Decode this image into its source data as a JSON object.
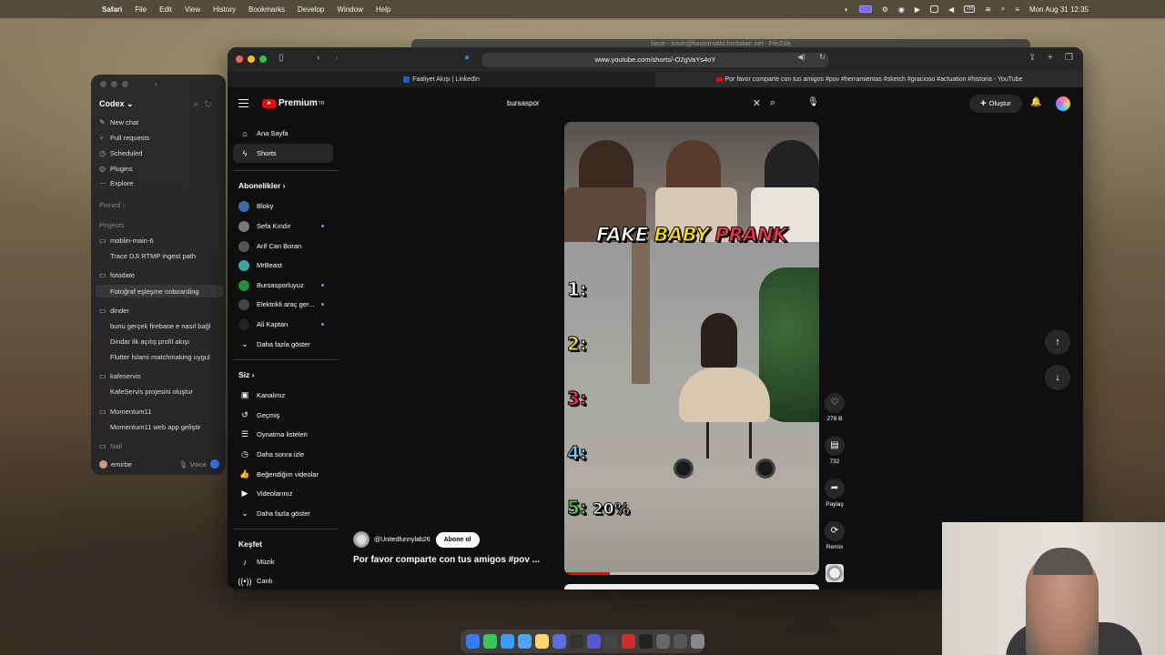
{
  "menubar": {
    "app": "Safari",
    "items": [
      "File",
      "Edit",
      "View",
      "History",
      "Bookmarks",
      "Develop",
      "Window",
      "Help"
    ],
    "clock": "Mon Aug 31  12:35",
    "lang": "TR"
  },
  "codex": {
    "title": "Codex",
    "nav": [
      {
        "label": "New chat",
        "icon": "compose-icon"
      },
      {
        "label": "Pull requests",
        "icon": "pr-icon"
      },
      {
        "label": "Scheduled",
        "icon": "clock-icon"
      },
      {
        "label": "Plugins",
        "icon": "plugin-icon"
      },
      {
        "label": "Explore",
        "icon": "dots-icon"
      }
    ],
    "pinned": "Pinned",
    "projects_label": "Projects",
    "projects": [
      {
        "name": "moblin-main-6",
        "items": [
          "Trace DJI RTMP ingest path"
        ]
      },
      {
        "name": "fotodate",
        "items": [
          "Fotoğraf eşleşme onboarding"
        ]
      },
      {
        "name": "dinder",
        "items": [
          "bunu gerçek firebase e nasıl bağl",
          "Dindar ilk açılış profil akışı",
          "Flutter İslami matchmaking uygul"
        ]
      },
      {
        "name": "kafeservis",
        "items": [
          "KafeServis projesini oluştur"
        ]
      },
      {
        "name": "Momentum11",
        "items": [
          "Momentum11 web app geliştir"
        ]
      },
      {
        "name": "Nail",
        "items": []
      }
    ],
    "user": "emirbe",
    "voice": "Voice"
  },
  "filezilla": {
    "title": "kavin - kavin@kavinmiatto.hostalain.net - FileZilla"
  },
  "safari": {
    "url": "www.youtube.com/shorts/-O2gVaYs4oY",
    "tabs": [
      {
        "label": "Faaliyet Akışı | LinkedIn"
      },
      {
        "label": "Por favor comparte con tus amigos #pov #herramientas #sketch #gracioso #actuation #historia - YouTube"
      }
    ]
  },
  "youtube": {
    "logo": "Premium",
    "logo_sup": "TR",
    "search_value": "bursaspor",
    "create_label": "Oluştur",
    "sidebar": {
      "main": [
        {
          "label": "Ana Sayfa",
          "icon": "home-icon"
        },
        {
          "label": "Shorts",
          "icon": "shorts-icon"
        }
      ],
      "subs_head": "Abonelikler",
      "subs": [
        {
          "label": "Bloky",
          "color": "#3b6ea8",
          "dot": false
        },
        {
          "label": "Sefa Kındır",
          "color": "#777777",
          "dot": true
        },
        {
          "label": "Arif Can Boran",
          "color": "#555555",
          "dot": false
        },
        {
          "label": "MrBeast",
          "color": "#3aa7a0",
          "dot": false
        },
        {
          "label": "Bursasporluyuz",
          "color": "#1f8f3a",
          "dot": true
        },
        {
          "label": "Elektrikli araç ger...",
          "color": "#444444",
          "dot": true
        },
        {
          "label": "Ali Kaptan",
          "color": "#222222",
          "dot": true
        }
      ],
      "more1": "Daha fazla göster",
      "you_head": "Siz",
      "you": [
        {
          "label": "Kanalınız",
          "icon": "channel-icon"
        },
        {
          "label": "Geçmiş",
          "icon": "history-icon"
        },
        {
          "label": "Oynatma listeleri",
          "icon": "playlist-icon"
        },
        {
          "label": "Daha sonra izle",
          "icon": "watch-later-icon"
        },
        {
          "label": "Beğendiğim videolar",
          "icon": "like-icon"
        },
        {
          "label": "Videolarınız",
          "icon": "video-icon"
        }
      ],
      "more2": "Daha fazla göster",
      "explore_head": "Keşfet",
      "explore": [
        {
          "label": "Müzik",
          "icon": "music-icon"
        },
        {
          "label": "Canlı",
          "icon": "live-icon"
        }
      ]
    },
    "short": {
      "overlay_title": [
        "FAKE",
        "BABY",
        "PRANK"
      ],
      "numbers": [
        "1:",
        "2:",
        "3:",
        "4:",
        "5:"
      ],
      "number_colors": [
        "#ffffff",
        "#ffe100",
        "#ff3050",
        "#7fc8ff",
        "#4bd04b"
      ],
      "percent": "20%",
      "progress": 0.18,
      "channel": "@Unitedfunnylab26",
      "subscribe": "Abone ol",
      "title": "Por favor comparte con tus amigos #pov ..."
    },
    "actions": {
      "likes": "278 B",
      "comments": "732",
      "share": "Paylaş",
      "remix": "Remix"
    }
  }
}
